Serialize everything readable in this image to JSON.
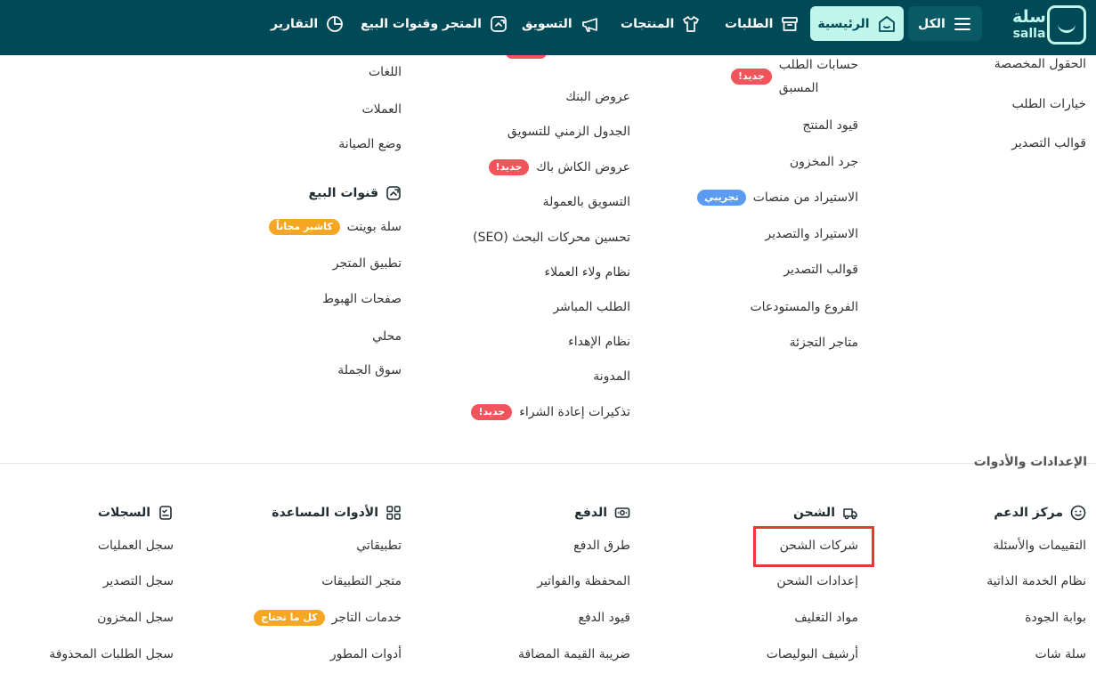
{
  "nav": {
    "logo_ar": "سلة",
    "logo_en": "salla",
    "all": "الكل",
    "home": "الرئيسية",
    "orders": "الطلبات",
    "products": "المنتجات",
    "marketing": "التسويق",
    "store_channels": "المتجر وقنوات البيع",
    "reports": "التقارير"
  },
  "col1": {
    "partial_top": "الحقول المخصصة",
    "order_options": "خيارات الطلب",
    "export_templates": "قوالب التصدير"
  },
  "col2": {
    "partial_top": "حسابات الطلب",
    "prepaid": "المسبق",
    "product_limits": "قيود المنتج",
    "inventory": "جرد المخزون",
    "import_platforms": "الاستيراد من منصات",
    "import_export": "الاستيراد والتصدير",
    "export_templates": "قوالب التصدير",
    "branches": "الفروع والمستودعات",
    "retail_stores": "متاجر التجزئة",
    "badge_new": "جديد!",
    "badge_beta": "تجريبي"
  },
  "col3": {
    "bank_offers": "عروض البنك",
    "marketing_schedule": "الجدول الزمني للتسويق",
    "cashback_offers": "عروض الكاش باك",
    "affiliate": "التسويق بالعمولة",
    "seo": "تحسين محركات البحث (SEO)",
    "loyalty": "نظام ولاء العملاء",
    "direct_order": "الطلب المباشر",
    "gifting": "نظام الإهداء",
    "blog": "المدونة",
    "repurchase": "تذكيرات إعادة الشراء",
    "badge_new": "جديد!"
  },
  "col4": {
    "languages": "اللغات",
    "currencies": "العملات",
    "maintenance": "وضع الصيانة",
    "sales_channels_head": "قنوات البيع",
    "salla_point": "سلة بوينت",
    "cashier_badge": "كاشير مجاناً",
    "store_app": "تطبيق المتجر",
    "landing_pages": "صفحات الهبوط",
    "local": "محلي",
    "wholesale": "سوق الجملة"
  },
  "settings_title": "الإعدادات والأدوات",
  "support": {
    "head": "مركز الدعم",
    "reviews": "التقييمات والأسئلة",
    "self_service": "نظام الخدمة الذاتية",
    "quality": "بوابة الجودة",
    "salla_chat": "سلة شات"
  },
  "shipping": {
    "head": "الشحن",
    "companies": "شركات الشحن",
    "settings": "إعدادات الشحن",
    "packaging": "مواد التغليف",
    "waybills": "أرشيف البوليصات"
  },
  "payment": {
    "head": "الدفع",
    "methods": "طرق الدفع",
    "wallet": "المحفظة والفواتير",
    "limits": "قيود الدفع",
    "vat": "ضريبة القيمة المضافة"
  },
  "tools": {
    "head": "الأدوات المساعدة",
    "my_apps": "تطبيقاتي",
    "app_store": "متجر التطبيقات",
    "merchant_services": "خدمات التاجر",
    "merchant_badge": "كل ما تحتاج",
    "dev_tools": "أدوات المطور"
  },
  "logs": {
    "head": "السجلات",
    "operations": "سجل العمليات",
    "export": "سجل التصدير",
    "inventory": "سجل المخزون",
    "deleted_orders": "سجل الطلبات المحذوفة"
  },
  "colors": {
    "nav_bg": "#004956",
    "accent": "#bff5ea",
    "badge_red": "#f2545b",
    "badge_orange": "#f5a623",
    "badge_blue": "#5b9cf0",
    "highlight": "#e53935"
  }
}
